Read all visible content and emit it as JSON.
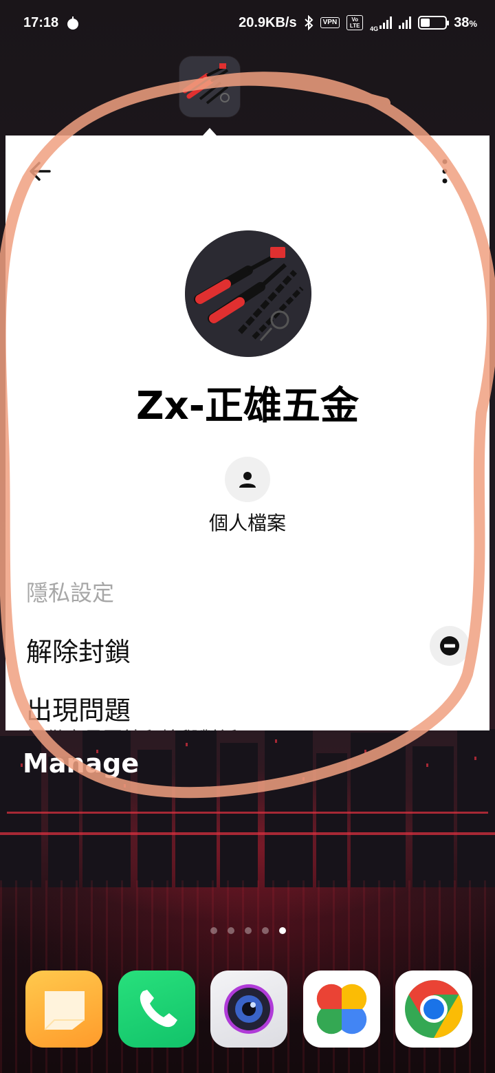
{
  "status_bar": {
    "time": "17:18",
    "network_speed": "20.9KB/s",
    "vpn_badge": "VPN",
    "volte_badge": "Vo LTE",
    "network_type": "4G",
    "battery_percent": "38",
    "battery_percent_symbol": "%",
    "battery_level": 0.38
  },
  "app": {
    "icon_name": "rivet-tool-app-icon"
  },
  "popup": {
    "profile_name": "Zx-正雄五金",
    "profile_button_label": "個人檔案",
    "privacy_section_title": "隱私設定",
    "unblock_label": "解除封鎖",
    "problem_label": "出現問題",
    "problem_sublabel": "提供意見回饋和檢舉對話"
  },
  "home": {
    "manage_label": "Manage",
    "page_count": 5,
    "active_page": 5,
    "dock": [
      {
        "name": "notes-app",
        "icon": "notes-icon"
      },
      {
        "name": "phone-app",
        "icon": "phone-icon"
      },
      {
        "name": "camera-app",
        "icon": "camera-icon"
      },
      {
        "name": "photos-app",
        "icon": "photos-icon"
      },
      {
        "name": "chrome-app",
        "icon": "chrome-icon"
      }
    ]
  },
  "colors": {
    "annotation_stroke": "#f0a080",
    "card_background": "#ffffff",
    "accent_red": "#e03030"
  }
}
